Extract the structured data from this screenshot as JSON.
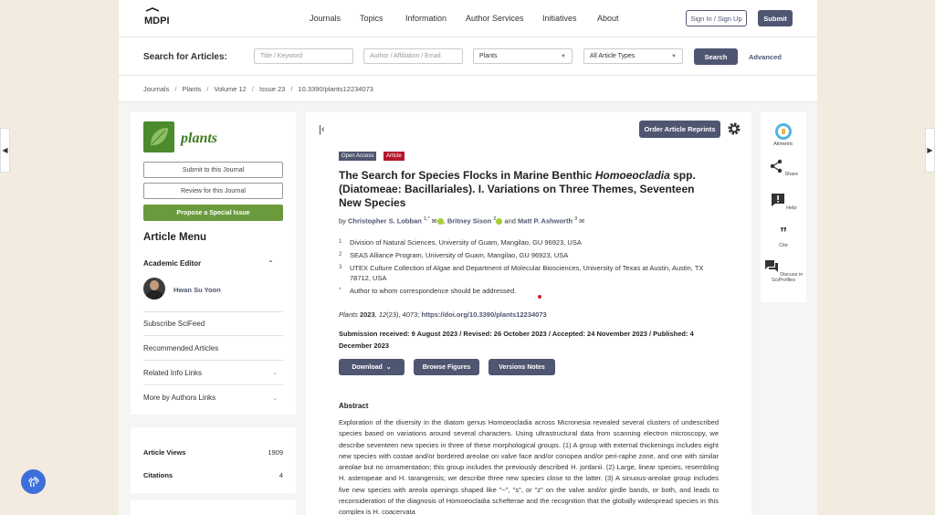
{
  "header": {
    "logo_text": "MDPI",
    "nav": [
      "Journals",
      "Topics",
      "Information",
      "Author Services",
      "Initiatives",
      "About"
    ],
    "sign_in": "Sign In / Sign Up",
    "submit": "Submit"
  },
  "search": {
    "label": "Search for Articles:",
    "title_placeholder": "Title / Keyword",
    "author_placeholder": "Author / Affiliation / Email",
    "journal_value": "Plants",
    "type_value": "All Article Types",
    "search_btn": "Search",
    "advanced": "Advanced"
  },
  "breadcrumb": [
    "Journals",
    "Plants",
    "Volume 12",
    "Issue 23",
    "10.3390/plants12234073"
  ],
  "sidebar": {
    "journal_name": "plants",
    "submit_btn": "Submit to this Journal",
    "review_btn": "Review for this Journal",
    "propose_btn": "Propose a Special Issue",
    "menu_title": "Article Menu",
    "academic_editor": "Academic Editor",
    "editor_name": "Hwan Su Yoon",
    "items": [
      "Subscribe SciFeed",
      "Recommended Articles",
      "Related Info Links",
      "More by Authors Links"
    ]
  },
  "stats": {
    "views_label": "Article Views",
    "views_value": "1909",
    "citations_label": "Citations",
    "citations_value": "4"
  },
  "article": {
    "reprints_btn": "Order Article Reprints",
    "badge_open": "Open Access",
    "badge_type": "Article",
    "title_a": "The Search for Species Flocks in Marine Benthic ",
    "title_genus": "Homoeocladia",
    "title_b": " spp. (Diatomeae: Bacillariales). I. Variations on Three Themes, Seventeen New Species",
    "by": "by",
    "author1": "Christopher S. Lobban",
    "author1_sup": "1,*",
    "author2": "Britney Sison",
    "author2_sup": "2",
    "and": "and",
    "author3": "Matt P. Ashworth",
    "author3_sup": "3",
    "affiliations": [
      {
        "num": "1",
        "text": "Division of Natural Sciences, University of Guam, Mangilao, GU 96923, USA"
      },
      {
        "num": "2",
        "text": "SEAS Alliance Program, University of Guam, Mangilao, GU 96923, USA"
      },
      {
        "num": "3",
        "text": "UTEX Culture Collection of Algae and Department of Molecular Biosciences, University of Texas at Austin, Austin, TX 78712, USA"
      },
      {
        "num": "*",
        "text": "Author to whom correspondence should be addressed."
      }
    ],
    "cite_journal": "Plants",
    "cite_year": "2023",
    "cite_vol": "12",
    "cite_rest": "(23), 4073;",
    "cite_doi": "https://doi.org/10.3390/plants12234073",
    "dates": "Submission received: 9 August 2023 / Revised: 26 October 2023 / Accepted: 24 November 2023 / Published: 4 December 2023",
    "download_btn": "Download",
    "figures_btn": "Browse Figures",
    "versions_btn": "Versions Notes",
    "abstract_heading": "Abstract",
    "abstract_text": "Exploration of the diversity in the diatom genus Homoeocladia across Micronesia revealed several clusters of undescribed species based on variations around several characters. Using ultrastructural data from scanning electron microscopy, we describe seventeen new species in three of these morphological groups. (1) A group with external thickenings includes eight new species with costae and/or bordered areolae on valve face and/or conopea and/or peri-raphe zone, and one with similar areolae but no ornamentation; this group includes the previously described H. jordanii. (2) Large, linear species, resembling H. asteropeae and H. tarangensis; we describe three new species close to the latter. (3) A sinuous-areolae group includes five new species with areola openings shaped like \"~\", \"s\", or \"z\" on the valve and/or girdle bands, or both, and leads to reconsideration of the diagnosis of Homoeocladia schefterae and the recognition that the globally widespread species in this complex is H. coacervata"
  },
  "right_panel": [
    "Altmetric",
    "Share",
    "Help",
    "Cite",
    "Discuss in SciProfiles"
  ]
}
